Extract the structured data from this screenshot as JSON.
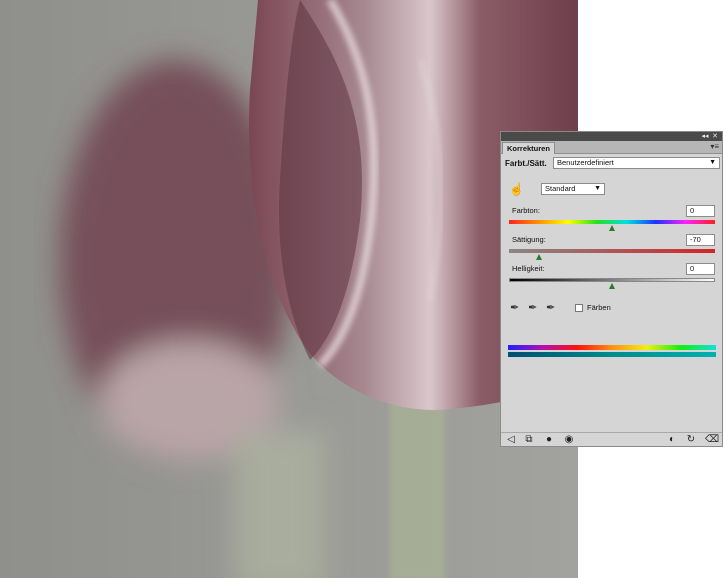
{
  "panel": {
    "tab_label": "Korrekturen",
    "collapse_glyph": "◂◂",
    "close_glyph": "✕",
    "menu_glyph": "▾≡",
    "title": "Farbt./Sätt.",
    "preset": "Benutzerdefiniert",
    "range": "Standard",
    "hue": {
      "label": "Farbton:",
      "value": "0",
      "fraction": 0.5
    },
    "saturation": {
      "label": "Sättigung:",
      "value": "-70",
      "fraction": 0.15
    },
    "lightness": {
      "label": "Helligkeit:",
      "value": "0",
      "fraction": 0.5
    },
    "colorize_label": "Färben",
    "colorize_checked": false
  },
  "icons": {
    "hand": "hand-icon",
    "eyedropper": "eyedropper-icon",
    "eyedropper_plus": "eyedropper-plus-icon",
    "eyedropper_minus": "eyedropper-minus-icon",
    "footer": [
      "return-icon",
      "clip-layer-icon",
      "mask-icon",
      "visibility-icon",
      "view-previous-icon",
      "reset-icon",
      "delete-icon"
    ]
  },
  "colors": {
    "tulip": "#7d4a55",
    "background": "#9c9c99",
    "stem": "#a7ad98",
    "panel": "#d5d5d5",
    "thumb": "#2c7a2c"
  }
}
